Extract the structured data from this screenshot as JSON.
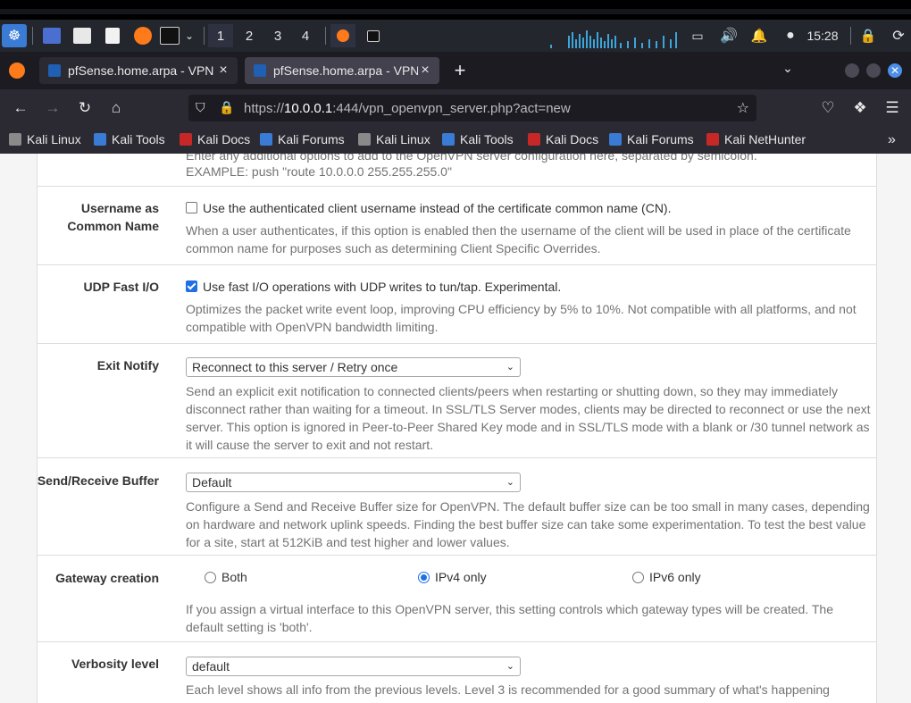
{
  "taskbar": {
    "workspaces": [
      "1",
      "2",
      "3",
      "4"
    ],
    "clock": "15:28",
    "icons": [
      "kali-menu-icon",
      "terminal-icon",
      "files-icon",
      "editor-icon",
      "firefox-icon",
      "speaker-icon",
      "bell-icon",
      "lock-icon",
      "power-icon"
    ]
  },
  "browser": {
    "tabs": [
      {
        "title": "pfSense.home.arpa - VPN",
        "close": "×"
      },
      {
        "title": "pfSense.home.arpa - VPN",
        "close": "×"
      }
    ],
    "new_tab": "+",
    "url_prefix": "https://",
    "url_host": "10.0.0.1",
    "url_rest": ":444/vpn_openvpn_server.php?act=new",
    "bookmarks": [
      "Kali Linux",
      "Kali Tools",
      "Kali Docs",
      "Kali Forums",
      "Kali Linux",
      "Kali Tools",
      "Kali Docs",
      "Kali Forums",
      "Kali NetHunter"
    ]
  },
  "form": {
    "custom_options_help_top": "Enter any additional options to add to the OpenVPN server configuration here, separated by semicolon.",
    "custom_options_example": "EXAMPLE: push \"route 10.0.0.0 255.255.255.0\"",
    "username_cn": {
      "label": "Username as Common Name",
      "checkbox_text": "Use the authenticated client username instead of the certificate common name (CN).",
      "checked": false,
      "help": "When a user authenticates, if this option is enabled then the username of the client will be used in place of the certificate common name for purposes such as determining Client Specific Overrides."
    },
    "udp_fast_io": {
      "label": "UDP Fast I/O",
      "checkbox_text": "Use fast I/O operations with UDP writes to tun/tap. Experimental.",
      "checked": true,
      "help": "Optimizes the packet write event loop, improving CPU efficiency by 5% to 10%. Not compatible with all platforms, and not compatible with OpenVPN bandwidth limiting."
    },
    "exit_notify": {
      "label": "Exit Notify",
      "value": "Reconnect to this server / Retry once",
      "help": "Send an explicit exit notification to connected clients/peers when restarting or shutting down, so they may immediately disconnect rather than waiting for a timeout. In SSL/TLS Server modes, clients may be directed to reconnect or use the next server. This option is ignored in Peer-to-Peer Shared Key mode and in SSL/TLS mode with a blank or /30 tunnel network as it will cause the server to exit and not restart."
    },
    "buffer": {
      "label": "Send/Receive Buffer",
      "value": "Default",
      "help": "Configure a Send and Receive Buffer size for OpenVPN. The default buffer size can be too small in many cases, depending on hardware and network uplink speeds. Finding the best buffer size can take some experimentation. To test the best value for a site, start at 512KiB and test higher and lower values."
    },
    "gateway": {
      "label": "Gateway creation",
      "options": [
        "Both",
        "IPv4 only",
        "IPv6 only"
      ],
      "selected": "IPv4 only",
      "help": "If you assign a virtual interface to this OpenVPN server, this setting controls which gateway types will be created. The default setting is 'both'."
    },
    "verbosity": {
      "label": "Verbosity level",
      "value": "default",
      "help": "Each level shows all info from the previous levels. Level 3 is recommended for a good summary of what's happening"
    }
  }
}
